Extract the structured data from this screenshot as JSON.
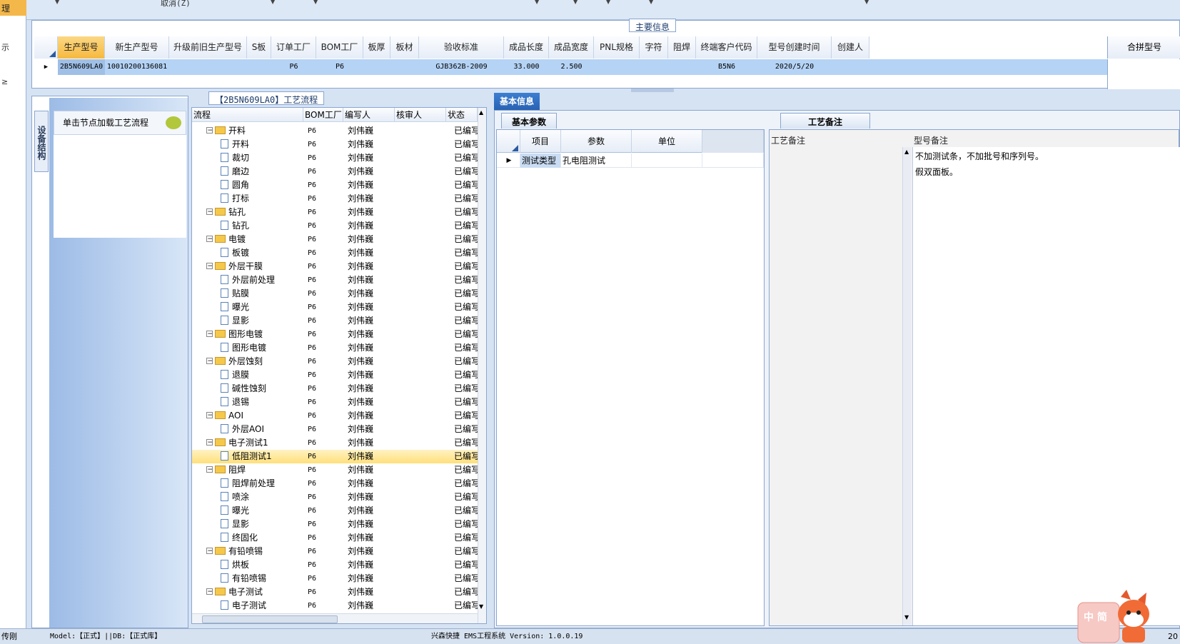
{
  "left_strip": {
    "active": "理",
    "items": [
      "示",
      "≥"
    ]
  },
  "topbar": {
    "cancel": "取消(Z)"
  },
  "main_info": {
    "caption": "主要信息",
    "columns": [
      "生产型号",
      "新生产型号",
      "升级前旧生产型号",
      "S板",
      "订单工厂",
      "BOM工厂",
      "板厚",
      "板材",
      "验收标准",
      "成品长度",
      "成品宽度",
      "PNL规格",
      "字符",
      "阻焊",
      "终端客户代码",
      "型号创建时间",
      "创建人"
    ],
    "row": [
      "2B5N609LA0",
      "10010200136081",
      "",
      "",
      "P6",
      "P6",
      "",
      "",
      "GJB362B-2009",
      "33.000",
      "2.500",
      "",
      "",
      "",
      "B5N6",
      "2020/5/20",
      ""
    ],
    "right_header": "合拼型号"
  },
  "left_panel": {
    "vertical_tab": "设备结构",
    "hint": "单击节点加载工艺流程"
  },
  "flow": {
    "caption": "【2B5N609LA0】工艺流程",
    "headers": [
      "流程",
      "BOM工厂",
      "编写人",
      "核审人",
      "状态"
    ],
    "rows": [
      {
        "t": "f",
        "name": "开料",
        "bom": "P6",
        "writer": "刘伟巍",
        "status": "已编写"
      },
      {
        "t": "c",
        "name": "开料",
        "bom": "P6",
        "writer": "刘伟巍",
        "status": "已编写"
      },
      {
        "t": "c",
        "name": "裁切",
        "bom": "P6",
        "writer": "刘伟巍",
        "status": "已编写"
      },
      {
        "t": "c",
        "name": "磨边",
        "bom": "P6",
        "writer": "刘伟巍",
        "status": "已编写"
      },
      {
        "t": "c",
        "name": "圆角",
        "bom": "P6",
        "writer": "刘伟巍",
        "status": "已编写"
      },
      {
        "t": "c",
        "name": "打标",
        "bom": "P6",
        "writer": "刘伟巍",
        "status": "已编写"
      },
      {
        "t": "f",
        "name": "钻孔",
        "bom": "P6",
        "writer": "刘伟巍",
        "status": "已编写"
      },
      {
        "t": "c",
        "name": "钻孔",
        "bom": "P6",
        "writer": "刘伟巍",
        "status": "已编写"
      },
      {
        "t": "f",
        "name": "电镀",
        "bom": "P6",
        "writer": "刘伟巍",
        "status": "已编写"
      },
      {
        "t": "c",
        "name": "板镀",
        "bom": "P6",
        "writer": "刘伟巍",
        "status": "已编写"
      },
      {
        "t": "f",
        "name": "外层干膜",
        "bom": "P6",
        "writer": "刘伟巍",
        "status": "已编写"
      },
      {
        "t": "c",
        "name": "外层前处理",
        "bom": "P6",
        "writer": "刘伟巍",
        "status": "已编写"
      },
      {
        "t": "c",
        "name": "贴膜",
        "bom": "P6",
        "writer": "刘伟巍",
        "status": "已编写"
      },
      {
        "t": "c",
        "name": "曝光",
        "bom": "P6",
        "writer": "刘伟巍",
        "status": "已编写"
      },
      {
        "t": "c",
        "name": "显影",
        "bom": "P6",
        "writer": "刘伟巍",
        "status": "已编写"
      },
      {
        "t": "f",
        "name": "图形电镀",
        "bom": "P6",
        "writer": "刘伟巍",
        "status": "已编写"
      },
      {
        "t": "c",
        "name": "图形电镀",
        "bom": "P6",
        "writer": "刘伟巍",
        "status": "已编写"
      },
      {
        "t": "f",
        "name": "外层蚀刻",
        "bom": "P6",
        "writer": "刘伟巍",
        "status": "已编写"
      },
      {
        "t": "c",
        "name": "退膜",
        "bom": "P6",
        "writer": "刘伟巍",
        "status": "已编写"
      },
      {
        "t": "c",
        "name": "碱性蚀刻",
        "bom": "P6",
        "writer": "刘伟巍",
        "status": "已编写"
      },
      {
        "t": "c",
        "name": "退锡",
        "bom": "P6",
        "writer": "刘伟巍",
        "status": "已编写"
      },
      {
        "t": "f",
        "name": "AOI",
        "bom": "P6",
        "writer": "刘伟巍",
        "status": "已编写"
      },
      {
        "t": "c",
        "name": "外层AOI",
        "bom": "P6",
        "writer": "刘伟巍",
        "status": "已编写"
      },
      {
        "t": "f",
        "name": "电子测试1",
        "bom": "P6",
        "writer": "刘伟巍",
        "status": "已编写"
      },
      {
        "t": "c",
        "name": "低阻测试1",
        "bom": "P6",
        "writer": "刘伟巍",
        "status": "已编写",
        "selected": true
      },
      {
        "t": "f",
        "name": "阻焊",
        "bom": "P6",
        "writer": "刘伟巍",
        "status": "已编写"
      },
      {
        "t": "c",
        "name": "阻焊前处理",
        "bom": "P6",
        "writer": "刘伟巍",
        "status": "已编写"
      },
      {
        "t": "c",
        "name": "喷涂",
        "bom": "P6",
        "writer": "刘伟巍",
        "status": "已编写"
      },
      {
        "t": "c",
        "name": "曝光",
        "bom": "P6",
        "writer": "刘伟巍",
        "status": "已编写"
      },
      {
        "t": "c",
        "name": "显影",
        "bom": "P6",
        "writer": "刘伟巍",
        "status": "已编写"
      },
      {
        "t": "c",
        "name": "终固化",
        "bom": "P6",
        "writer": "刘伟巍",
        "status": "已编写"
      },
      {
        "t": "f",
        "name": "有铅喷锡",
        "bom": "P6",
        "writer": "刘伟巍",
        "status": "已编写"
      },
      {
        "t": "c",
        "name": "烘板",
        "bom": "P6",
        "writer": "刘伟巍",
        "status": "已编写"
      },
      {
        "t": "c",
        "name": "有铅喷锡",
        "bom": "P6",
        "writer": "刘伟巍",
        "status": "已编写"
      },
      {
        "t": "f",
        "name": "电子测试",
        "bom": "P6",
        "writer": "刘伟巍",
        "status": "已编写"
      },
      {
        "t": "c",
        "name": "电子测试",
        "bom": "P6",
        "writer": "刘伟巍",
        "status": "已编写"
      }
    ]
  },
  "basic": {
    "tab": "基本信息",
    "subtab_params": "基本参数",
    "subtab_remarks": "工艺备注",
    "param_headers": [
      "项目",
      "参数",
      "单位"
    ],
    "param_row": {
      "item": "测试类型",
      "value": "孔电阻测试",
      "unit": ""
    },
    "remark_col1": "工艺备注",
    "remark_col2": "型号备注",
    "remark_lines": [
      "不加测试条，不加批号和序列号。",
      "假双面板。"
    ]
  },
  "status": {
    "user": "传刚",
    "model": "Model:【正式】||DB:【正式库】",
    "title": "兴森快捷 EMS工程系统 Version: 1.0.0.19",
    "right": "20"
  },
  "ime": {
    "label": "中 简"
  }
}
